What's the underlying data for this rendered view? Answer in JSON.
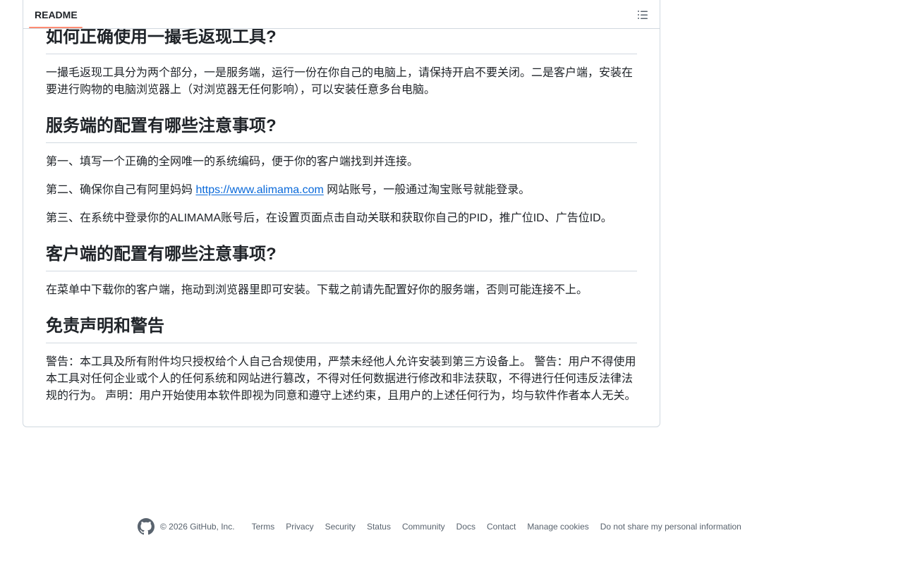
{
  "readme": {
    "tab_label": "README",
    "outline_icon": "list-unordered-icon"
  },
  "article": {
    "sections": [
      {
        "heading": "如何正确使用一撮毛返现工具?",
        "paragraphs": [
          "一撮毛返现工具分为两个部分，一是服务端，运行一份在你自己的电脑上，请保持开启不要关闭。二是客户端，安装在要进行购物的电脑浏览器上（对浏览器无任何影响），可以安装任意多台电脑。"
        ]
      },
      {
        "heading": "服务端的配置有哪些注意事项?",
        "paragraphs": [
          "第一、填写一个正确的全网唯一的系统编码，便于你的客户端找到并连接。",
          "第三、在系统中登录你的ALIMAMA账号后，在设置页面点击自动关联和获取你自己的PID，推广位ID、广告位ID。"
        ],
        "p2_prefix": "第二、确保你自己有阿里妈妈 ",
        "p2_link": "https://www.alimama.com",
        "p2_suffix": " 网站账号，一般通过淘宝账号就能登录。"
      },
      {
        "heading": "客户端的配置有哪些注意事项?",
        "paragraphs": [
          "在菜单中下载你的客户端，拖动到浏览器里即可安装。下载之前请先配置好你的服务端，否则可能连接不上。"
        ]
      },
      {
        "heading": "免责声明和警告",
        "paragraphs": [
          "警告：本工具及所有附件均只授权给个人自己合规使用，严禁未经他人允许安装到第三方设备上。 警告：用户不得使用本工具对任何企业或个人的任何系统和网站进行篡改，不得对任何数据进行修改和非法获取，不得进行任何违反法律法规的行为。 声明：用户开始使用本软件即视为同意和遵守上述约束，且用户的上述任何行为，均与软件作者本人无关。"
        ]
      }
    ]
  },
  "footer": {
    "logo_icon": "github-mark-icon",
    "copyright": "© 2026 GitHub, Inc.",
    "links": [
      "Terms",
      "Privacy",
      "Security",
      "Status",
      "Community",
      "Docs",
      "Contact",
      "Manage cookies",
      "Do not share my personal information"
    ]
  }
}
